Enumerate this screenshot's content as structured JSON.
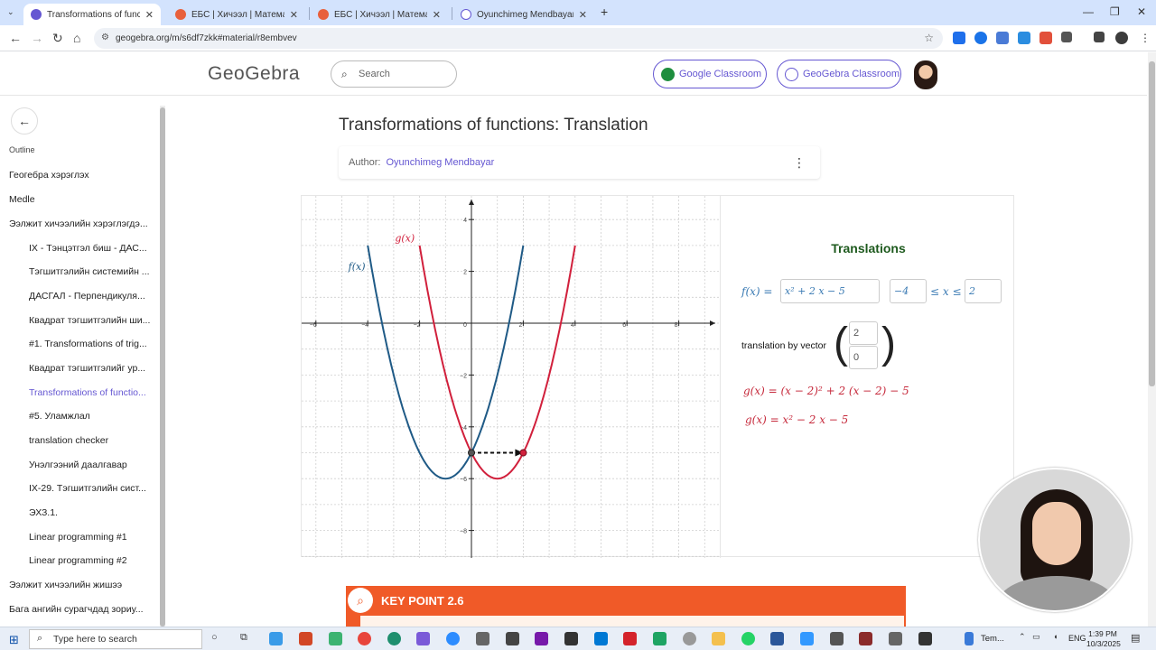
{
  "browser": {
    "tabs": [
      {
        "title": "Transformations of functions: T",
        "active": true,
        "favicon_color": "#6557d2"
      },
      {
        "title": "ЕБС | Хичээл | Математик 10 |",
        "active": false,
        "favicon_color": "#e8603c"
      },
      {
        "title": "ЕБС | Хичээл | Математик 10 |",
        "active": false,
        "favicon_color": "#e8603c"
      },
      {
        "title": "Oyunchimeg Mendbayar – Reso",
        "active": false,
        "favicon_color": "#6557d2"
      }
    ],
    "new_tab": "+",
    "url": "geogebra.org/m/s6df7zkk#material/r8embvev",
    "window_controls": {
      "minimize": "—",
      "restore": "❐",
      "close": "✕"
    }
  },
  "header": {
    "logo": "GeoGebra",
    "search_placeholder": "Search",
    "google_classroom": "Google Classroom",
    "geogebra_classroom": "GeoGebra Classroom",
    "accent": "#6557d2"
  },
  "sidebar": {
    "outline_label": "Outline",
    "items": [
      {
        "label": "Геогебра хэрэглэх",
        "level": "top"
      },
      {
        "label": "Medle",
        "level": "top"
      },
      {
        "label": "Ээлжит хичээлийн хэрэглэгдэ...",
        "level": "top"
      },
      {
        "label": "IX - Тэнцэтгэл биш - ДАС...",
        "level": "sub"
      },
      {
        "label": "Тэгшитгэлийн системийн ...",
        "level": "sub"
      },
      {
        "label": "ДАСГАЛ - Перпендикуля...",
        "level": "sub"
      },
      {
        "label": "Квадрат тэгшитгэлийн ши...",
        "level": "sub"
      },
      {
        "label": "#1. Transformations of trig...",
        "level": "sub"
      },
      {
        "label": "Квадрат тэгшитгэлийг ур...",
        "level": "sub"
      },
      {
        "label": "Transformations of functio...",
        "level": "sub",
        "active": true
      },
      {
        "label": "#5. Уламжлал",
        "level": "sub"
      },
      {
        "label": "translation checker",
        "level": "sub"
      },
      {
        "label": "Унэлгээний даалгавар",
        "level": "sub"
      },
      {
        "label": "IX-29. Тэгшитгэлийн сист...",
        "level": "sub"
      },
      {
        "label": "ЭХЗ.1.",
        "level": "sub"
      },
      {
        "label": "Linear programming #1",
        "level": "sub"
      },
      {
        "label": "Linear programming #2",
        "level": "sub"
      },
      {
        "label": "Ээлжит хичээлийн жишээ",
        "level": "top"
      },
      {
        "label": "Бага ангийн сурагчдад зориу...",
        "level": "top"
      }
    ]
  },
  "main": {
    "title": "Transformations of functions: Translation",
    "author_label": "Author:",
    "author_name": "Oyunchimeg Mendbayar",
    "menu_icon": "⋮"
  },
  "applet": {
    "graph": {
      "x_ticks": [
        "−6",
        "−4",
        "−2",
        "0",
        "2",
        "4",
        "6",
        "8"
      ],
      "y_ticks": [
        "4",
        "2",
        "−2",
        "−4",
        "−6",
        "−8"
      ],
      "f_label": "f(x)",
      "g_label": "g(x)",
      "f_color": "#1f5a86",
      "g_color": "#d1203c"
    },
    "algebra": {
      "title": "Translations",
      "f_prefix": "f(x) =",
      "f_expr": "x² + 2 x − 5",
      "domain_min": "−4",
      "domain_mid": "≤ x ≤",
      "domain_max": "2",
      "vector_label": "translation by vector",
      "vector_x": "2",
      "vector_y": "0",
      "g_line1": "g(x) = (x − 2)² + 2 (x − 2) − 5",
      "g_line2": "g(x) = x² − 2 x − 5"
    }
  },
  "keypoint": {
    "label": "KEY POINT 2.6"
  },
  "taskbar": {
    "search_placeholder": "Type here to search",
    "task_label": "Tem...",
    "lang": "ENG",
    "time": "1:39 PM",
    "date": "10/3/2025"
  },
  "chart_data": {
    "type": "line",
    "x_range": [
      -6.5,
      9.5
    ],
    "y_range": [
      -8.8,
      4.6
    ],
    "grid": true,
    "series": [
      {
        "name": "f(x)",
        "formula": "x^2 + 2x - 5",
        "domain": [
          -4,
          2
        ],
        "points": [
          [
            -4,
            3
          ],
          [
            -3,
            -2
          ],
          [
            -2,
            -5
          ],
          [
            -1,
            -6
          ],
          [
            0,
            -5
          ],
          [
            1,
            -2
          ],
          [
            2,
            3
          ]
        ]
      },
      {
        "name": "g(x)",
        "formula": "x^2 - 2x - 5",
        "domain": [
          -2,
          4
        ],
        "points": [
          [
            -2,
            3
          ],
          [
            -1,
            -2
          ],
          [
            0,
            -5
          ],
          [
            1,
            -6
          ],
          [
            2,
            -5
          ],
          [
            3,
            -2
          ],
          [
            4,
            3
          ]
        ]
      }
    ],
    "translation_arrow": {
      "from": [
        0,
        -5
      ],
      "to": [
        2,
        -5
      ]
    }
  }
}
